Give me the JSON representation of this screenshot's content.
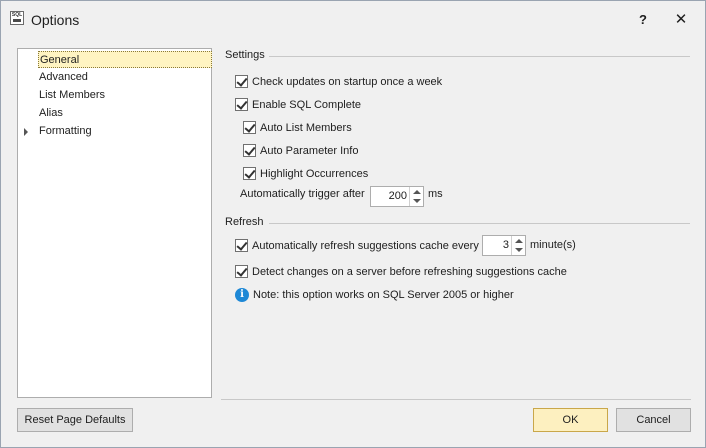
{
  "window": {
    "title": "Options",
    "icon_text": "SQL",
    "help_label": "?",
    "close_label": "✕"
  },
  "nav": {
    "items": [
      {
        "label": "General",
        "selected": true
      },
      {
        "label": "Advanced"
      },
      {
        "label": "List Members"
      },
      {
        "label": "Alias"
      },
      {
        "label": "Formatting",
        "expandable": true
      }
    ]
  },
  "settings": {
    "header": "Settings",
    "check_updates": {
      "label": "Check updates on startup once a week",
      "checked": true
    },
    "enable_sql_complete": {
      "label": "Enable SQL Complete",
      "checked": true
    },
    "auto_list_members": {
      "label": "Auto List Members",
      "checked": true
    },
    "auto_parameter_info": {
      "label": "Auto Parameter Info",
      "checked": true
    },
    "highlight_occurrences": {
      "label": "Highlight Occurrences",
      "checked": true
    },
    "trigger_label": "Automatically trigger after",
    "trigger_value": "200",
    "trigger_unit": "ms"
  },
  "refresh": {
    "header": "Refresh",
    "auto_refresh": {
      "label": "Automatically refresh suggestions cache every",
      "checked": true
    },
    "refresh_value": "3",
    "refresh_unit": "minute(s)",
    "detect_changes": {
      "label": "Detect changes on a server before refreshing suggestions cache",
      "checked": true
    },
    "note": "Note: this option works on SQL Server 2005 or higher",
    "note_icon": "info-icon"
  },
  "buttons": {
    "reset": "Reset Page Defaults",
    "ok": "OK",
    "cancel": "Cancel"
  }
}
